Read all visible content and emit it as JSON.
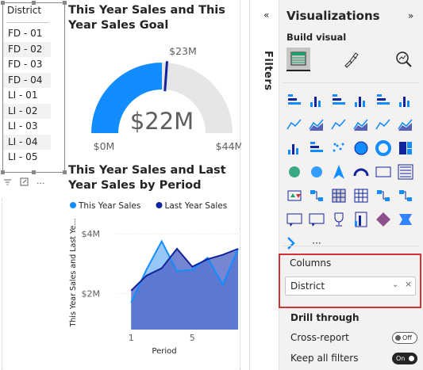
{
  "slicer": {
    "title": "District",
    "items": [
      {
        "label": "FD - 01",
        "shaded": false
      },
      {
        "label": "FD - 02",
        "shaded": true
      },
      {
        "label": "FD - 03",
        "shaded": false
      },
      {
        "label": "FD - 04",
        "shaded": true
      },
      {
        "label": "LI - 01",
        "shaded": false
      },
      {
        "label": "LI - 02",
        "shaded": true
      },
      {
        "label": "LI - 03",
        "shaded": false
      },
      {
        "label": "LI - 04",
        "shaded": true
      },
      {
        "label": "LI - 05",
        "shaded": false
      }
    ],
    "more_label": "···"
  },
  "gauge": {
    "title": "This Year Sales and This Year Sales Goal",
    "value_label": "$22M",
    "min_label": "$0M",
    "max_label": "$44M",
    "target_label": "$23M",
    "value": 22,
    "min": 0,
    "max": 44,
    "target": 23,
    "fill_color": "#118DFF",
    "track_color": "#E6E6E6",
    "target_color": "#12239E"
  },
  "chart_data": {
    "type": "area",
    "title": "This Year Sales and Last Year Sales by Period",
    "xlabel": "Period",
    "ylabel": "This Year Sales and Last Ye...",
    "x": [
      1,
      2,
      3,
      4,
      5,
      6,
      7,
      8
    ],
    "xlim": [
      0,
      8
    ],
    "xticks": [
      {
        "value": 1,
        "label": "1"
      },
      {
        "value": 5,
        "label": "5"
      }
    ],
    "ylim": [
      0.8,
      4.4
    ],
    "yticks": [
      {
        "value": 2,
        "label": "$2M"
      },
      {
        "value": 4,
        "label": "$4M"
      }
    ],
    "legend_position": "top",
    "series": [
      {
        "name": "This Year Sales",
        "color": "#118DFF",
        "values": [
          1.7,
          2.8,
          3.75,
          2.75,
          2.8,
          3.2,
          2.3,
          3.5
        ]
      },
      {
        "name": "Last Year Sales",
        "color": "#12239E",
        "values": [
          2.1,
          2.6,
          2.85,
          3.5,
          2.9,
          3.15,
          3.3,
          3.5
        ]
      }
    ]
  },
  "filters": {
    "label": "Filters",
    "collapse_icon": "chevron-left-double-icon"
  },
  "viz": {
    "title": "Visualizations",
    "expand_icon": "chevron-right-double-icon",
    "build_label": "Build visual",
    "more_label": "···",
    "columns_label": "Columns",
    "field_value": "District",
    "drill_label": "Drill through",
    "cross_report_label": "Cross-report",
    "cross_report_state": "Off",
    "keep_filters_label": "Keep all filters",
    "keep_filters_state": "On"
  }
}
